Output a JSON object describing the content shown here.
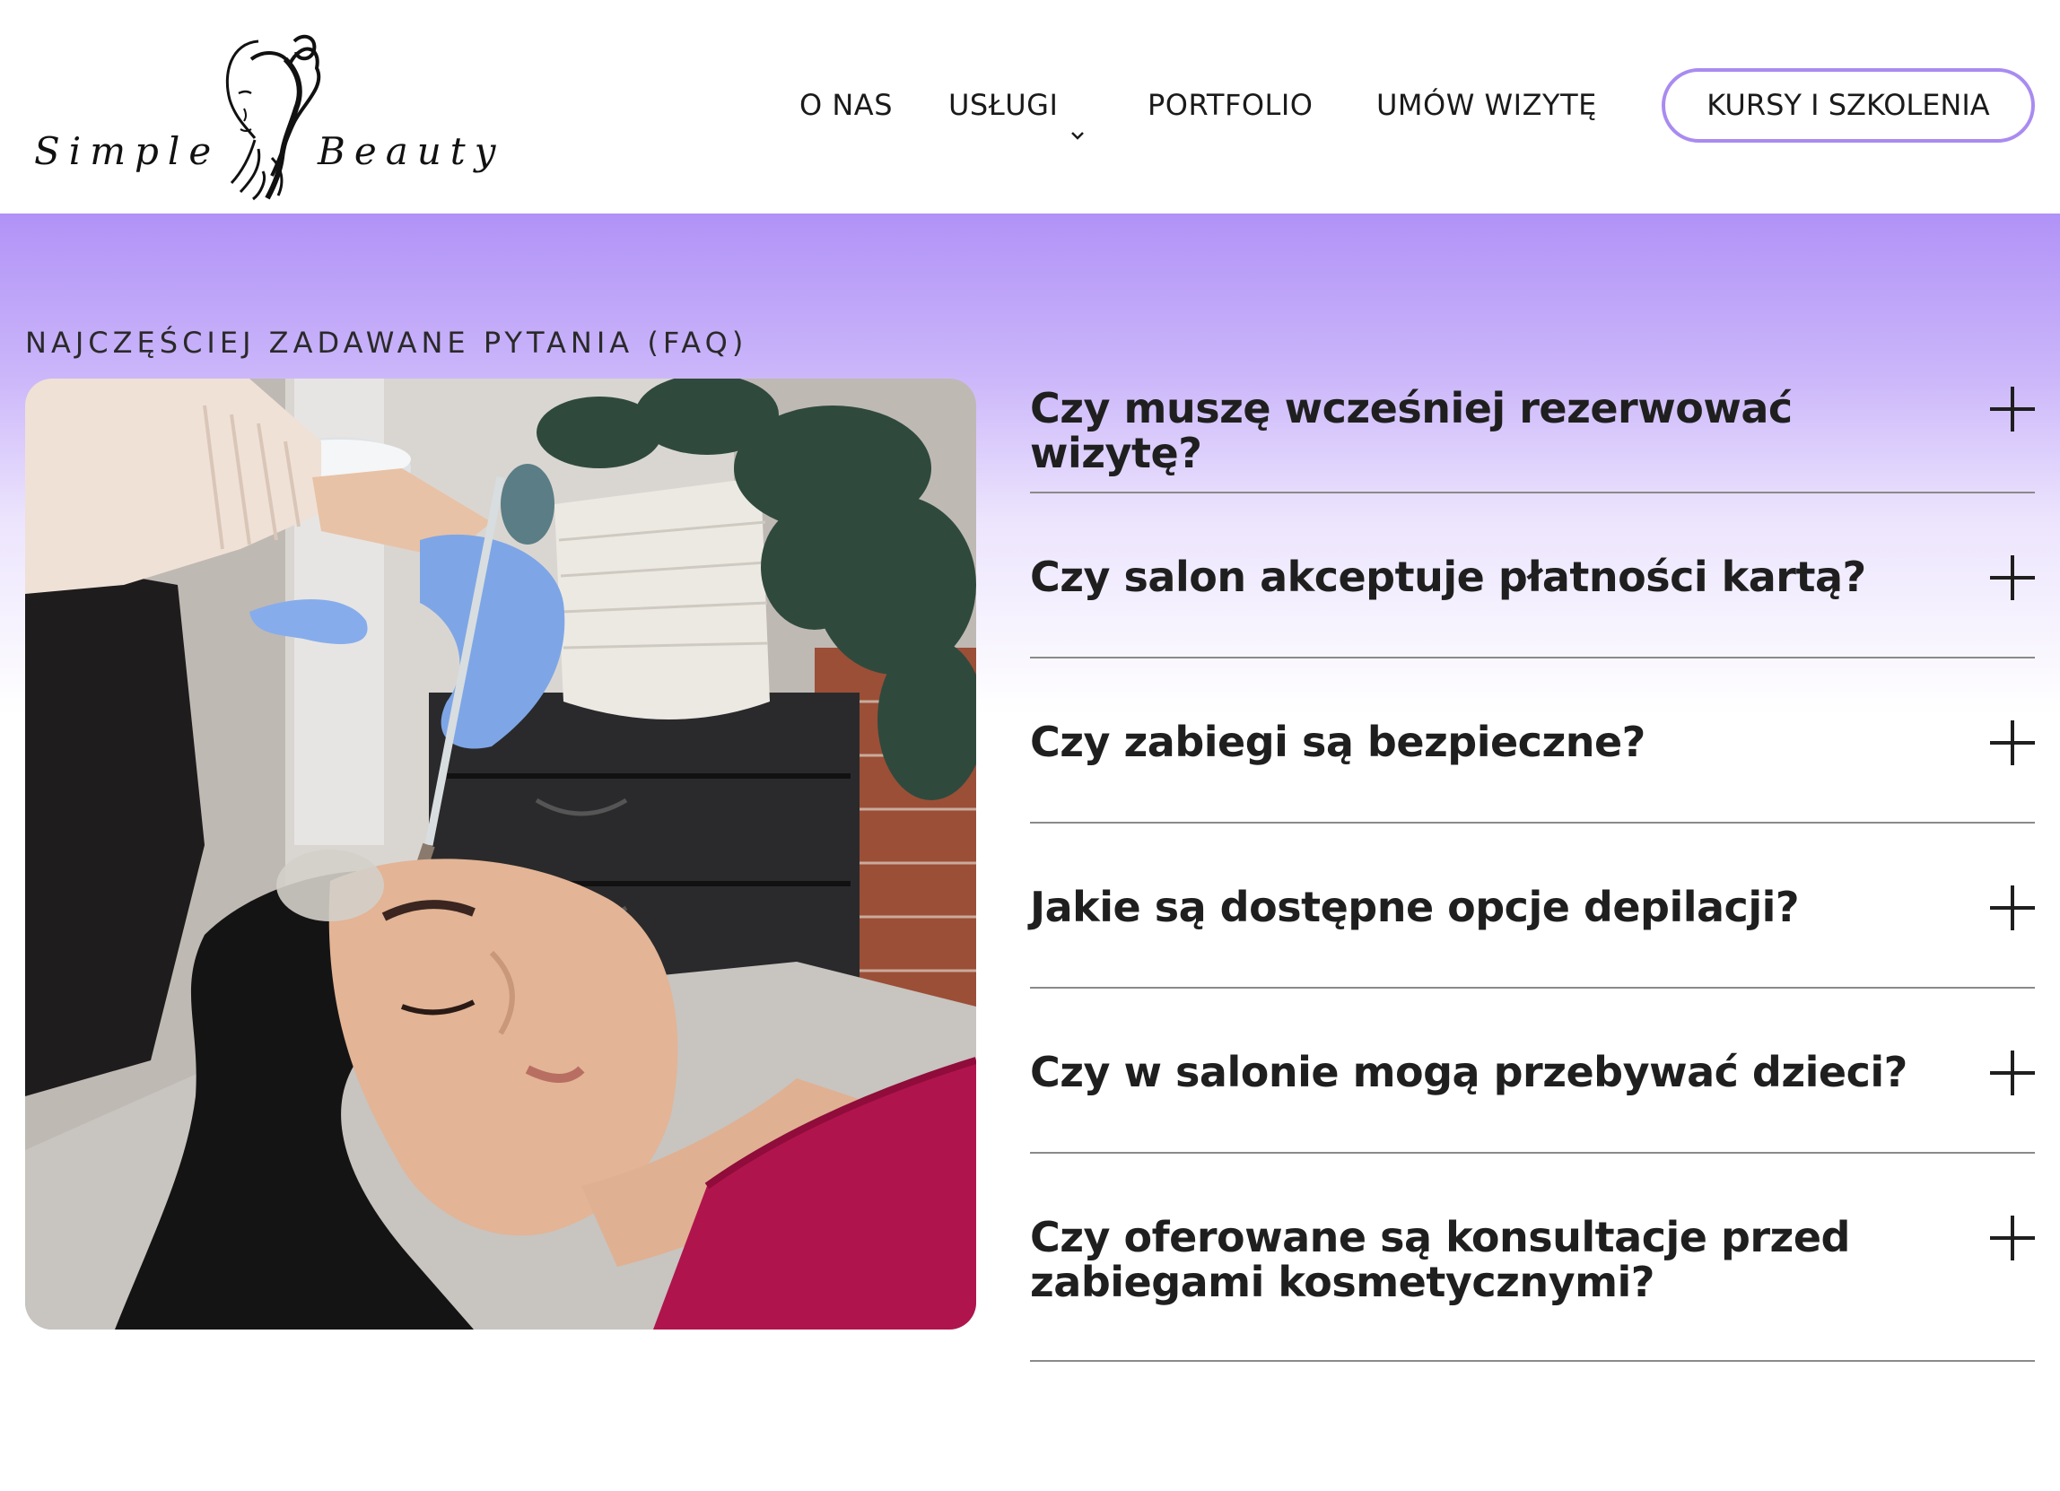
{
  "brand": {
    "logo_left": "Simple",
    "logo_right": "Beauty"
  },
  "nav": {
    "items": [
      {
        "label": "O NAS"
      },
      {
        "label": "USŁUGI",
        "has_dropdown": true
      },
      {
        "label": "PORTFOLIO"
      },
      {
        "label": "UMÓW WIZYTĘ"
      }
    ],
    "cta": "KURSY I SZKOLENIA"
  },
  "faq": {
    "eyebrow": "NAJCZĘŚCIEJ ZADAWANE PYTANIA (FAQ)",
    "items": [
      {
        "question": "Czy muszę wcześniej rezerwować wizytę?"
      },
      {
        "question": "Czy salon akceptuje płatności kartą?"
      },
      {
        "question": "Czy zabiegi są bezpieczne?"
      },
      {
        "question": "Jakie są dostępne opcje depilacji?"
      },
      {
        "question": "Czy w salonie mogą przebywać dzieci?"
      },
      {
        "question": "Czy oferowane są konsultacje przed zabiegami kosmetycznymi?"
      }
    ]
  },
  "icons": {
    "dropdown": "chevron-down-icon",
    "expand": "plus-icon"
  },
  "colors": {
    "accent": "#a98bf0",
    "gradient_top": "#b192f7",
    "text": "#1f1f1f",
    "divider": "#8a8a8a"
  }
}
